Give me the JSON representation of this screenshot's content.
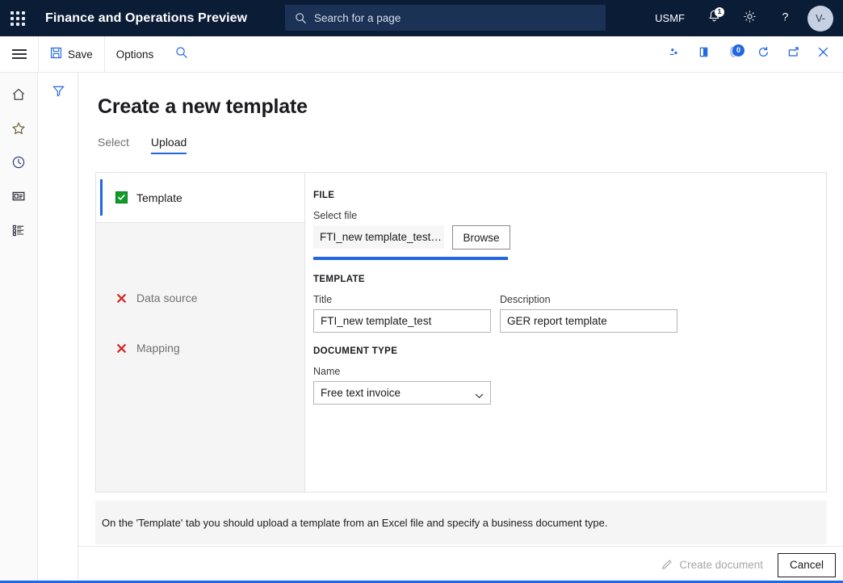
{
  "topnav": {
    "waffle_icon": "app-launcher-icon",
    "app_title": "Finance and Operations Preview",
    "search": {
      "icon": "search-icon",
      "placeholder": "Search for a page",
      "value": ""
    },
    "company": "USMF",
    "notifications": {
      "icon": "bell-icon",
      "badge": "1"
    },
    "settings_icon": "gear-icon",
    "help_icon": "question-mark-icon",
    "avatar_initials": "V-"
  },
  "actionbar": {
    "menu_icon": "hamburger-icon",
    "save_label": "Save",
    "save_icon": "save-disk-icon",
    "options_label": "Options",
    "search_icon": "search-icon",
    "right_icons": [
      {
        "name": "relationships-icon",
        "badge": ""
      },
      {
        "name": "office-open-icon",
        "badge": ""
      },
      {
        "name": "attachments-icon",
        "badge": "0"
      },
      {
        "name": "refresh-icon",
        "badge": ""
      },
      {
        "name": "open-in-new-window-icon",
        "badge": ""
      },
      {
        "name": "close-icon",
        "badge": ""
      }
    ]
  },
  "rail": {
    "items": [
      {
        "name": "home-icon",
        "label": "Home"
      },
      {
        "name": "favorites-star-icon",
        "label": "Favorites"
      },
      {
        "name": "recent-clock-icon",
        "label": "Recent"
      },
      {
        "name": "workspaces-icon",
        "label": "Workspaces"
      },
      {
        "name": "modules-list-icon",
        "label": "Modules"
      }
    ]
  },
  "filterpane": {
    "filter_icon": "filter-funnel-icon"
  },
  "main": {
    "page_title": "Create a new template",
    "tabs": [
      {
        "label": "Select",
        "active": false
      },
      {
        "label": "Upload",
        "active": true
      }
    ],
    "steps": [
      {
        "label": "Template",
        "status": "complete",
        "status_icon": "green-check-icon",
        "active": true
      },
      {
        "label": "Data source",
        "status": "incomplete",
        "status_icon": "red-x-icon",
        "active": false
      },
      {
        "label": "Mapping",
        "status": "incomplete",
        "status_icon": "red-x-icon",
        "active": false
      }
    ],
    "file_section": {
      "heading": "FILE",
      "select_file_label": "Select file",
      "file_name": "FTI_new template_test…",
      "browse_label": "Browse",
      "progress_percent": 100
    },
    "template_section": {
      "heading": "TEMPLATE",
      "title_label": "Title",
      "title_value": "FTI_new template_test",
      "description_label": "Description",
      "description_value": "GER report template"
    },
    "document_type_section": {
      "heading": "DOCUMENT TYPE",
      "name_label": "Name",
      "name_value": "Free text invoice",
      "chevron_icon": "chevron-down-icon"
    },
    "info_message": "On the 'Template' tab you should upload a template from an Excel file and specify a business document type.",
    "footer": {
      "create_label": "Create document",
      "create_icon": "pencil-edit-icon",
      "create_disabled": true,
      "cancel_label": "Cancel"
    }
  },
  "colors": {
    "nav_background": "#0b1c36",
    "accent_blue": "#2266e3",
    "success_green": "#0f9d28",
    "error_red": "#d32626",
    "panel_gray": "#f5f5f5"
  }
}
